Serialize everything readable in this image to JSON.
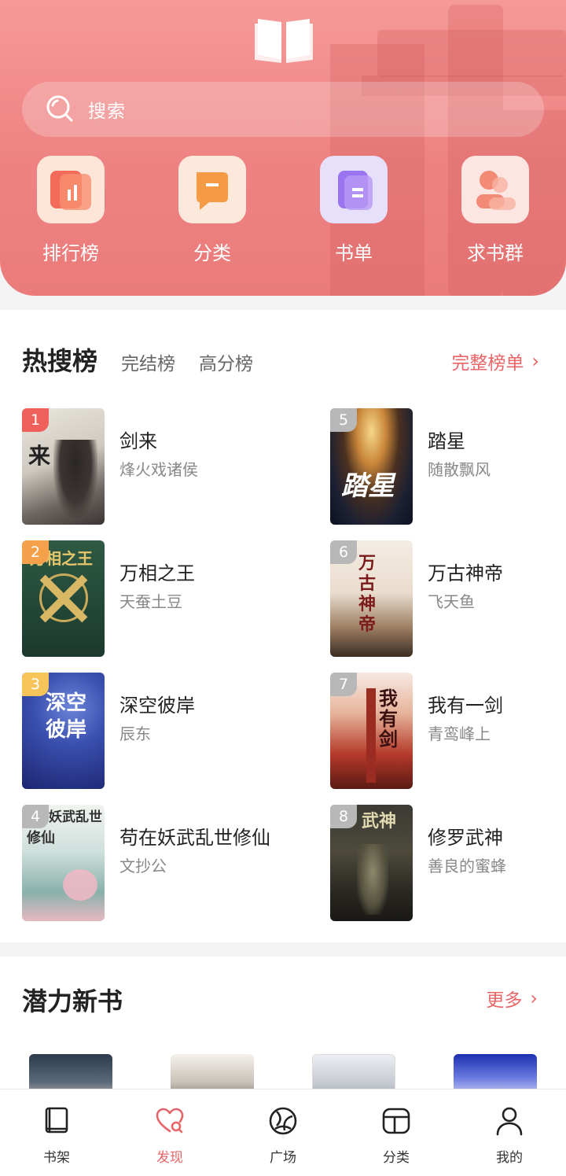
{
  "header": {
    "search_placeholder": "搜索",
    "quick_links": [
      {
        "label": "排行榜",
        "icon": "ranking-icon"
      },
      {
        "label": "分类",
        "icon": "category-icon"
      },
      {
        "label": "书单",
        "icon": "booklist-icon"
      },
      {
        "label": "求书群",
        "icon": "group-icon"
      }
    ]
  },
  "hot": {
    "tab_active": "热搜榜",
    "tab_finished": "完结榜",
    "tab_high_score": "高分榜",
    "full_list_label": "完整榜单",
    "items": [
      {
        "rank": "1",
        "title": "剑来",
        "author": "烽火戏诸侯"
      },
      {
        "rank": "2",
        "title": "万相之王",
        "author": "天蚕土豆"
      },
      {
        "rank": "3",
        "title": "深空彼岸",
        "author": "辰东"
      },
      {
        "rank": "4",
        "title": "苟在妖武乱世修仙",
        "author": "文抄公"
      },
      {
        "rank": "5",
        "title": "踏星",
        "author": "随散飘风"
      },
      {
        "rank": "6",
        "title": "万古神帝",
        "author": "飞天鱼"
      },
      {
        "rank": "7",
        "title": "我有一剑",
        "author": "青鸾峰上"
      },
      {
        "rank": "8",
        "title": "修罗武神",
        "author": "善良的蜜蜂"
      }
    ]
  },
  "potential": {
    "title": "潜力新书",
    "more_label": "更多"
  },
  "nav": {
    "items": [
      {
        "label": "书架"
      },
      {
        "label": "发现"
      },
      {
        "label": "广场"
      },
      {
        "label": "分类"
      },
      {
        "label": "我的"
      }
    ]
  },
  "colors": {
    "accent": "#e86466",
    "header": "#ee8282",
    "rank_top": [
      "#f0605a",
      "#f5a04a",
      "#f7c45a"
    ],
    "rank_rest": "#b8b8b8"
  }
}
